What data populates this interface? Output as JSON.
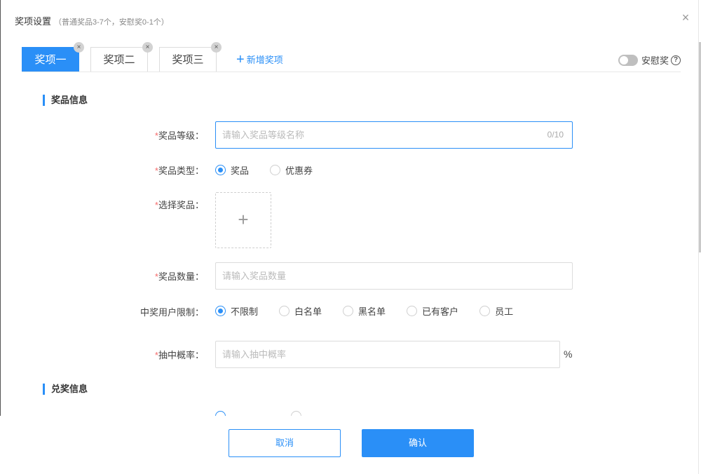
{
  "dialog": {
    "title": "奖项设置",
    "hint": "（普通奖品3-7个，安慰奖0-1个）",
    "close_symbol": "×"
  },
  "tabs": [
    {
      "label": "奖项一",
      "active": true,
      "remove_symbol": "×"
    },
    {
      "label": "奖项二",
      "active": false,
      "remove_symbol": "×"
    },
    {
      "label": "奖项三",
      "active": false,
      "remove_symbol": "×"
    }
  ],
  "add_tab": {
    "icon": "plus-icon",
    "label": "新增奖项",
    "plus_symbol": "+"
  },
  "consolation": {
    "label": "安慰奖",
    "enabled": false,
    "help_symbol": "?"
  },
  "sections": {
    "prize_info": "奖品信息",
    "redeem_info": "兑奖信息"
  },
  "form": {
    "required_mark": "*",
    "prize_level": {
      "label": "奖品等级：",
      "placeholder": "请输入奖品等级名称",
      "counter": "0/10"
    },
    "prize_type": {
      "label": "奖品类型：",
      "options": [
        "奖品",
        "优惠券"
      ],
      "selected": "奖品"
    },
    "select_prize": {
      "label": "选择奖品：",
      "upload_symbol": "+"
    },
    "prize_quantity": {
      "label": "奖品数量：",
      "placeholder": "请输入奖品数量"
    },
    "user_limit": {
      "label": "中奖用户限制：",
      "options": [
        "不限制",
        "白名单",
        "黑名单",
        "已有客户",
        "员工"
      ],
      "selected": "不限制"
    },
    "probability": {
      "label": "抽中概率：",
      "placeholder": "请输入抽中概率",
      "unit": "%"
    }
  },
  "buttons": {
    "cancel": "取消",
    "confirm": "确认"
  },
  "colors": {
    "accent": "#2a8ff7",
    "required": "#f56c6c"
  }
}
